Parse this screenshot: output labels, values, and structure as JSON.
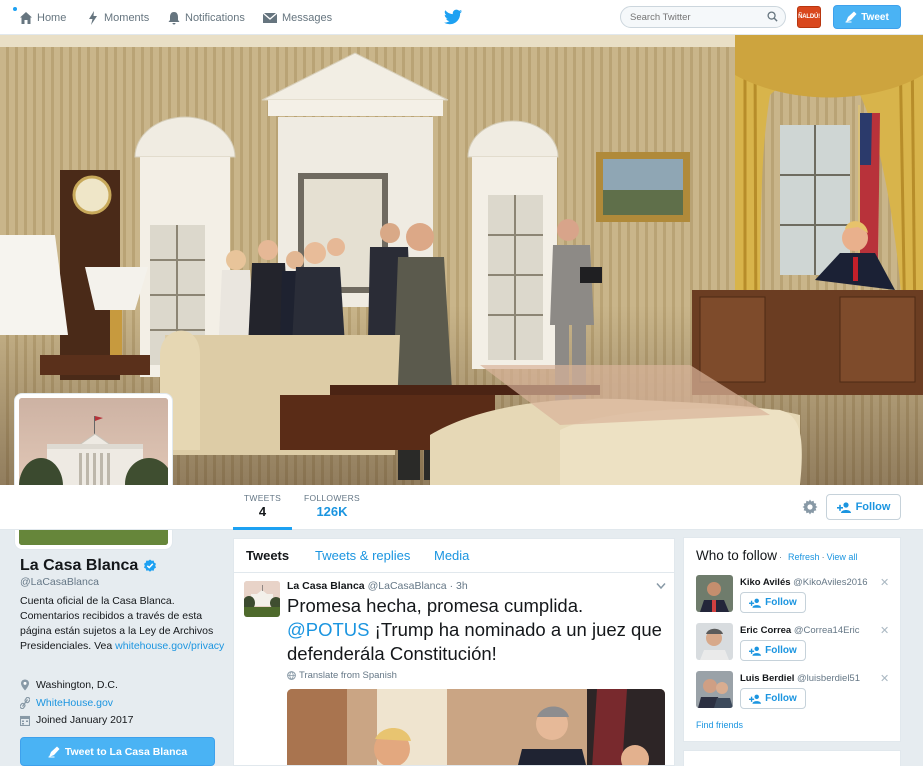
{
  "nav": {
    "home": "Home",
    "moments": "Moments",
    "notifications": "Notifications",
    "messages": "Messages",
    "search_placeholder": "Search Twitter",
    "tweet_button": "Tweet",
    "avatar_text": "ÑALDÚ!"
  },
  "profile": {
    "name": "La Casa Blanca",
    "handle": "@LaCasaBlanca",
    "bio": "Cuenta oficial de la Casa Blanca. Comentarios recibidos a través de esta página están sujetos a la Ley de Archivos Presidenciales. Vea",
    "bio_link": "whitehouse.gov/privacy",
    "location": "Washington, D.C.",
    "website": "WhiteHouse.gov",
    "joined": "Joined January 2017",
    "tweet_to_label": "Tweet to La Casa Blanca"
  },
  "stats": [
    {
      "label": "TWEETS",
      "value": "4"
    },
    {
      "label": "FOLLOWERS",
      "value": "126K"
    }
  ],
  "follow_label": "Follow",
  "timeline": {
    "tabs": [
      "Tweets",
      "Tweets & replies",
      "Media"
    ],
    "tweet": {
      "name": "La Casa Blanca",
      "handle": "@LaCasaBlanca",
      "time": "· 3h",
      "text_1": "Promesa hecha, promesa cumplida.",
      "mention": "@POTUS",
      "text_2": " ¡Trump ha nominado a un juez que defenderála Constitución!",
      "translate": "Translate from Spanish"
    }
  },
  "who_to_follow": {
    "title": "Who to follow",
    "refresh": "Refresh",
    "view_all": "View all",
    "find_friends": "Find friends",
    "suggestions": [
      {
        "name": "Kiko Avilés",
        "handle": "@KikoAviles2016",
        "follow": "Follow"
      },
      {
        "name": "Eric Correa",
        "handle": "@Correa14Eric",
        "follow": "Follow"
      },
      {
        "name": "Luis Berdiel",
        "handle": "@luisberdiel51",
        "follow": "Follow"
      }
    ]
  },
  "colors": {
    "accent": "#1da1f2",
    "link": "#1b95e0",
    "button_blue": "#4ab3f4"
  }
}
